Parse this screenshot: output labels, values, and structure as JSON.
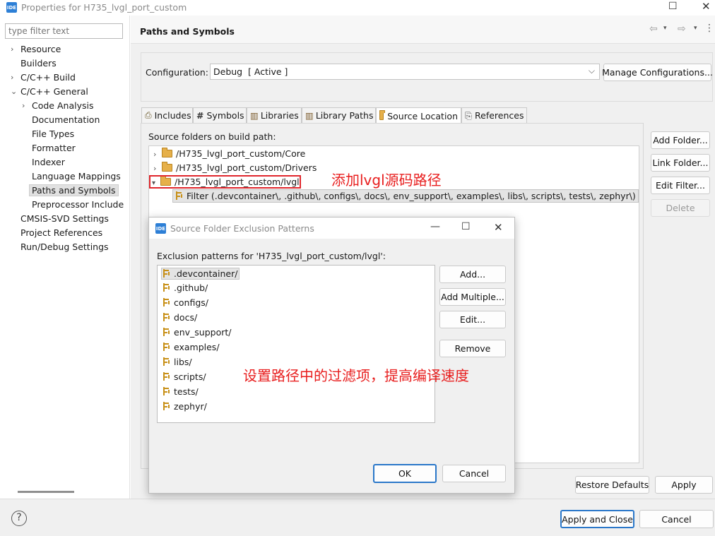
{
  "window": {
    "title": "Properties for H735_lvgl_port_custom",
    "icon": "IDE"
  },
  "filter": {
    "placeholder": "type filter text"
  },
  "nav": [
    {
      "label": "Resource",
      "chevron": "›"
    },
    {
      "label": "Builders",
      "chevron": ""
    },
    {
      "label": "C/C++ Build",
      "chevron": "›"
    },
    {
      "label": "C/C++ General",
      "chevron": "⌄"
    },
    {
      "label": "Code Analysis",
      "chevron": "›"
    },
    {
      "label": "Documentation",
      "chevron": ""
    },
    {
      "label": "File Types",
      "chevron": ""
    },
    {
      "label": "Formatter",
      "chevron": ""
    },
    {
      "label": "Indexer",
      "chevron": ""
    },
    {
      "label": "Language Mappings",
      "chevron": ""
    },
    {
      "label": "Paths and Symbols",
      "chevron": ""
    },
    {
      "label": "Preprocessor Include",
      "chevron": ""
    },
    {
      "label": "CMSIS-SVD Settings",
      "chevron": ""
    },
    {
      "label": "Project References",
      "chevron": ""
    },
    {
      "label": "Run/Debug Settings",
      "chevron": ""
    }
  ],
  "page": {
    "title": "Paths and Symbols"
  },
  "config": {
    "label": "Configuration:",
    "value": "Debug  [ Active ]",
    "manage": "Manage Configurations..."
  },
  "tabs": [
    "Includes",
    "Symbols",
    "Libraries",
    "Library Paths",
    "Source Location",
    "References"
  ],
  "source": {
    "heading": "Source folders on build path:",
    "folders": [
      "/H735_lvgl_port_custom/Core",
      "/H735_lvgl_port_custom/Drivers",
      "/H735_lvgl_port_custom/lvgl"
    ],
    "filter": "Filter (.devcontainer\\, .github\\, configs\\, docs\\, env_support\\, examples\\, libs\\, scripts\\, tests\\, zephyr\\)",
    "buttons": {
      "add_folder": "Add Folder...",
      "link_folder": "Link Folder...",
      "edit_filter": "Edit Filter...",
      "delete": "Delete"
    }
  },
  "annotations": {
    "add_path": "添加lvgl源码路径",
    "set_filter": "设置路径中的过滤项，提高编译速度"
  },
  "dialog": {
    "title": "Source Folder Exclusion Patterns",
    "label": "Exclusion patterns for 'H735_lvgl_port_custom/lvgl':",
    "patterns": [
      ".devcontainer/",
      ".github/",
      "configs/",
      "docs/",
      "env_support/",
      "examples/",
      "libs/",
      "scripts/",
      "tests/",
      "zephyr/"
    ],
    "buttons": {
      "add": "Add...",
      "add_multiple": "Add Multiple...",
      "edit": "Edit...",
      "remove": "Remove",
      "ok": "OK",
      "cancel": "Cancel"
    }
  },
  "footer": {
    "restore": "Restore Defaults",
    "apply": "Apply",
    "apply_close": "Apply and Close",
    "cancel": "Cancel",
    "help": "?"
  }
}
